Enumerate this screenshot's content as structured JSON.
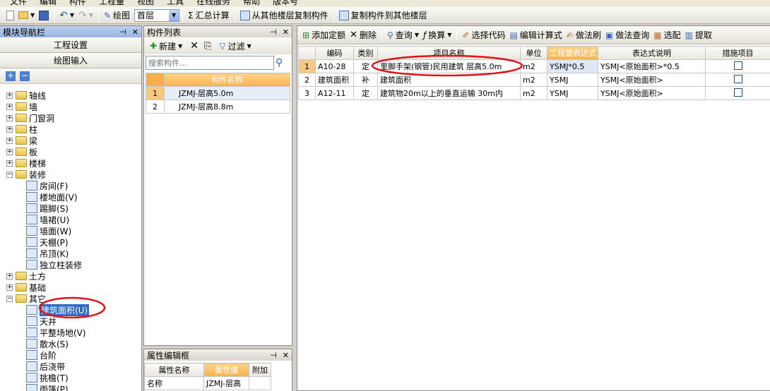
{
  "menubar": {
    "items": [
      "文件",
      "编辑",
      "构件",
      "工程量",
      "视图",
      "工具",
      "在线服务",
      "帮助",
      "版本号"
    ]
  },
  "toolbar": {
    "draw_label": "绘图",
    "floor_value": "首层",
    "sum_label": "汇总计算",
    "copy_from_label": "从其他楼层复制构件",
    "copy_to_label": "复制构件到其他楼层"
  },
  "nav": {
    "title": "模块导航栏",
    "btn_project": "工程设置",
    "btn_draw": "绘图输入",
    "tree": [
      {
        "label": "轴线",
        "type": "folder",
        "expanded": false
      },
      {
        "label": "墙",
        "type": "folder",
        "expanded": false
      },
      {
        "label": "门窗洞",
        "type": "folder",
        "expanded": false
      },
      {
        "label": "柱",
        "type": "folder",
        "expanded": false
      },
      {
        "label": "梁",
        "type": "folder",
        "expanded": false
      },
      {
        "label": "板",
        "type": "folder",
        "expanded": false
      },
      {
        "label": "楼梯",
        "type": "folder",
        "expanded": false
      },
      {
        "label": "装修",
        "type": "folder",
        "expanded": true
      },
      {
        "label": "房间(F)",
        "type": "leaf"
      },
      {
        "label": "楼地面(V)",
        "type": "leaf"
      },
      {
        "label": "踢脚(S)",
        "type": "leaf"
      },
      {
        "label": "墙裙(U)",
        "type": "leaf"
      },
      {
        "label": "墙面(W)",
        "type": "leaf"
      },
      {
        "label": "天棚(P)",
        "type": "leaf"
      },
      {
        "label": "吊顶(K)",
        "type": "leaf"
      },
      {
        "label": "独立柱装修",
        "type": "leaf"
      },
      {
        "label": "土方",
        "type": "folder",
        "expanded": false
      },
      {
        "label": "基础",
        "type": "folder",
        "expanded": false
      },
      {
        "label": "其它",
        "type": "folder",
        "expanded": true
      },
      {
        "label": "建筑面积(U)",
        "type": "leaf",
        "selected": true
      },
      {
        "label": "天井",
        "type": "leaf"
      },
      {
        "label": "平整场地(V)",
        "type": "leaf"
      },
      {
        "label": "散水(S)",
        "type": "leaf"
      },
      {
        "label": "台阶",
        "type": "leaf"
      },
      {
        "label": "后浇带",
        "type": "leaf"
      },
      {
        "label": "挑檐(T)",
        "type": "leaf"
      },
      {
        "label": "雨篷(P)",
        "type": "leaf"
      }
    ]
  },
  "complist": {
    "title": "构件列表",
    "new_label": "新建",
    "filter_label": "过滤",
    "search_placeholder": "搜索构件...",
    "col_name": "构件名称",
    "rows": [
      {
        "num": "1",
        "name": "JZMJ-层高5.0m"
      },
      {
        "num": "2",
        "name": "JZMJ-层高8.8m"
      }
    ]
  },
  "props": {
    "title": "属性编辑框",
    "col_name": "属性名称",
    "col_value": "属性值",
    "col_extra": "附加",
    "rows": [
      {
        "name": "名称",
        "value": "JZMJ-层高"
      }
    ]
  },
  "main_toolbar": {
    "add_quota": "添加定额",
    "delete": "删除",
    "query": "查询",
    "convert": "换算",
    "select_code": "选择代码",
    "edit_formula": "编辑计算式",
    "method_brush": "做法刷",
    "method_query": "做法查询",
    "select_match": "选配",
    "extract": "提取"
  },
  "grid": {
    "headers": [
      "编码",
      "类别",
      "项目名称",
      "单位",
      "工程量表达式",
      "表达式说明",
      "措施项目"
    ],
    "rows": [
      {
        "num": "1",
        "code": "A10-28",
        "type": "定",
        "name": "里脚手架(钢管)民用建筑 层高5.0m",
        "unit": "m2",
        "expr": "YSMJ*0.5",
        "desc": "YSMJ<原始面积>*0.5"
      },
      {
        "num": "2",
        "code": "建筑面积",
        "type": "补",
        "name": "建筑面积",
        "unit": "m2",
        "expr": "YSMJ",
        "desc": "YSMJ<原始面积>"
      },
      {
        "num": "3",
        "code": "A12-11",
        "type": "定",
        "name": "建筑物20m以上的垂直运输 30m内",
        "unit": "m2",
        "expr": "YSMJ",
        "desc": "YSMJ<原始面积>"
      }
    ]
  }
}
